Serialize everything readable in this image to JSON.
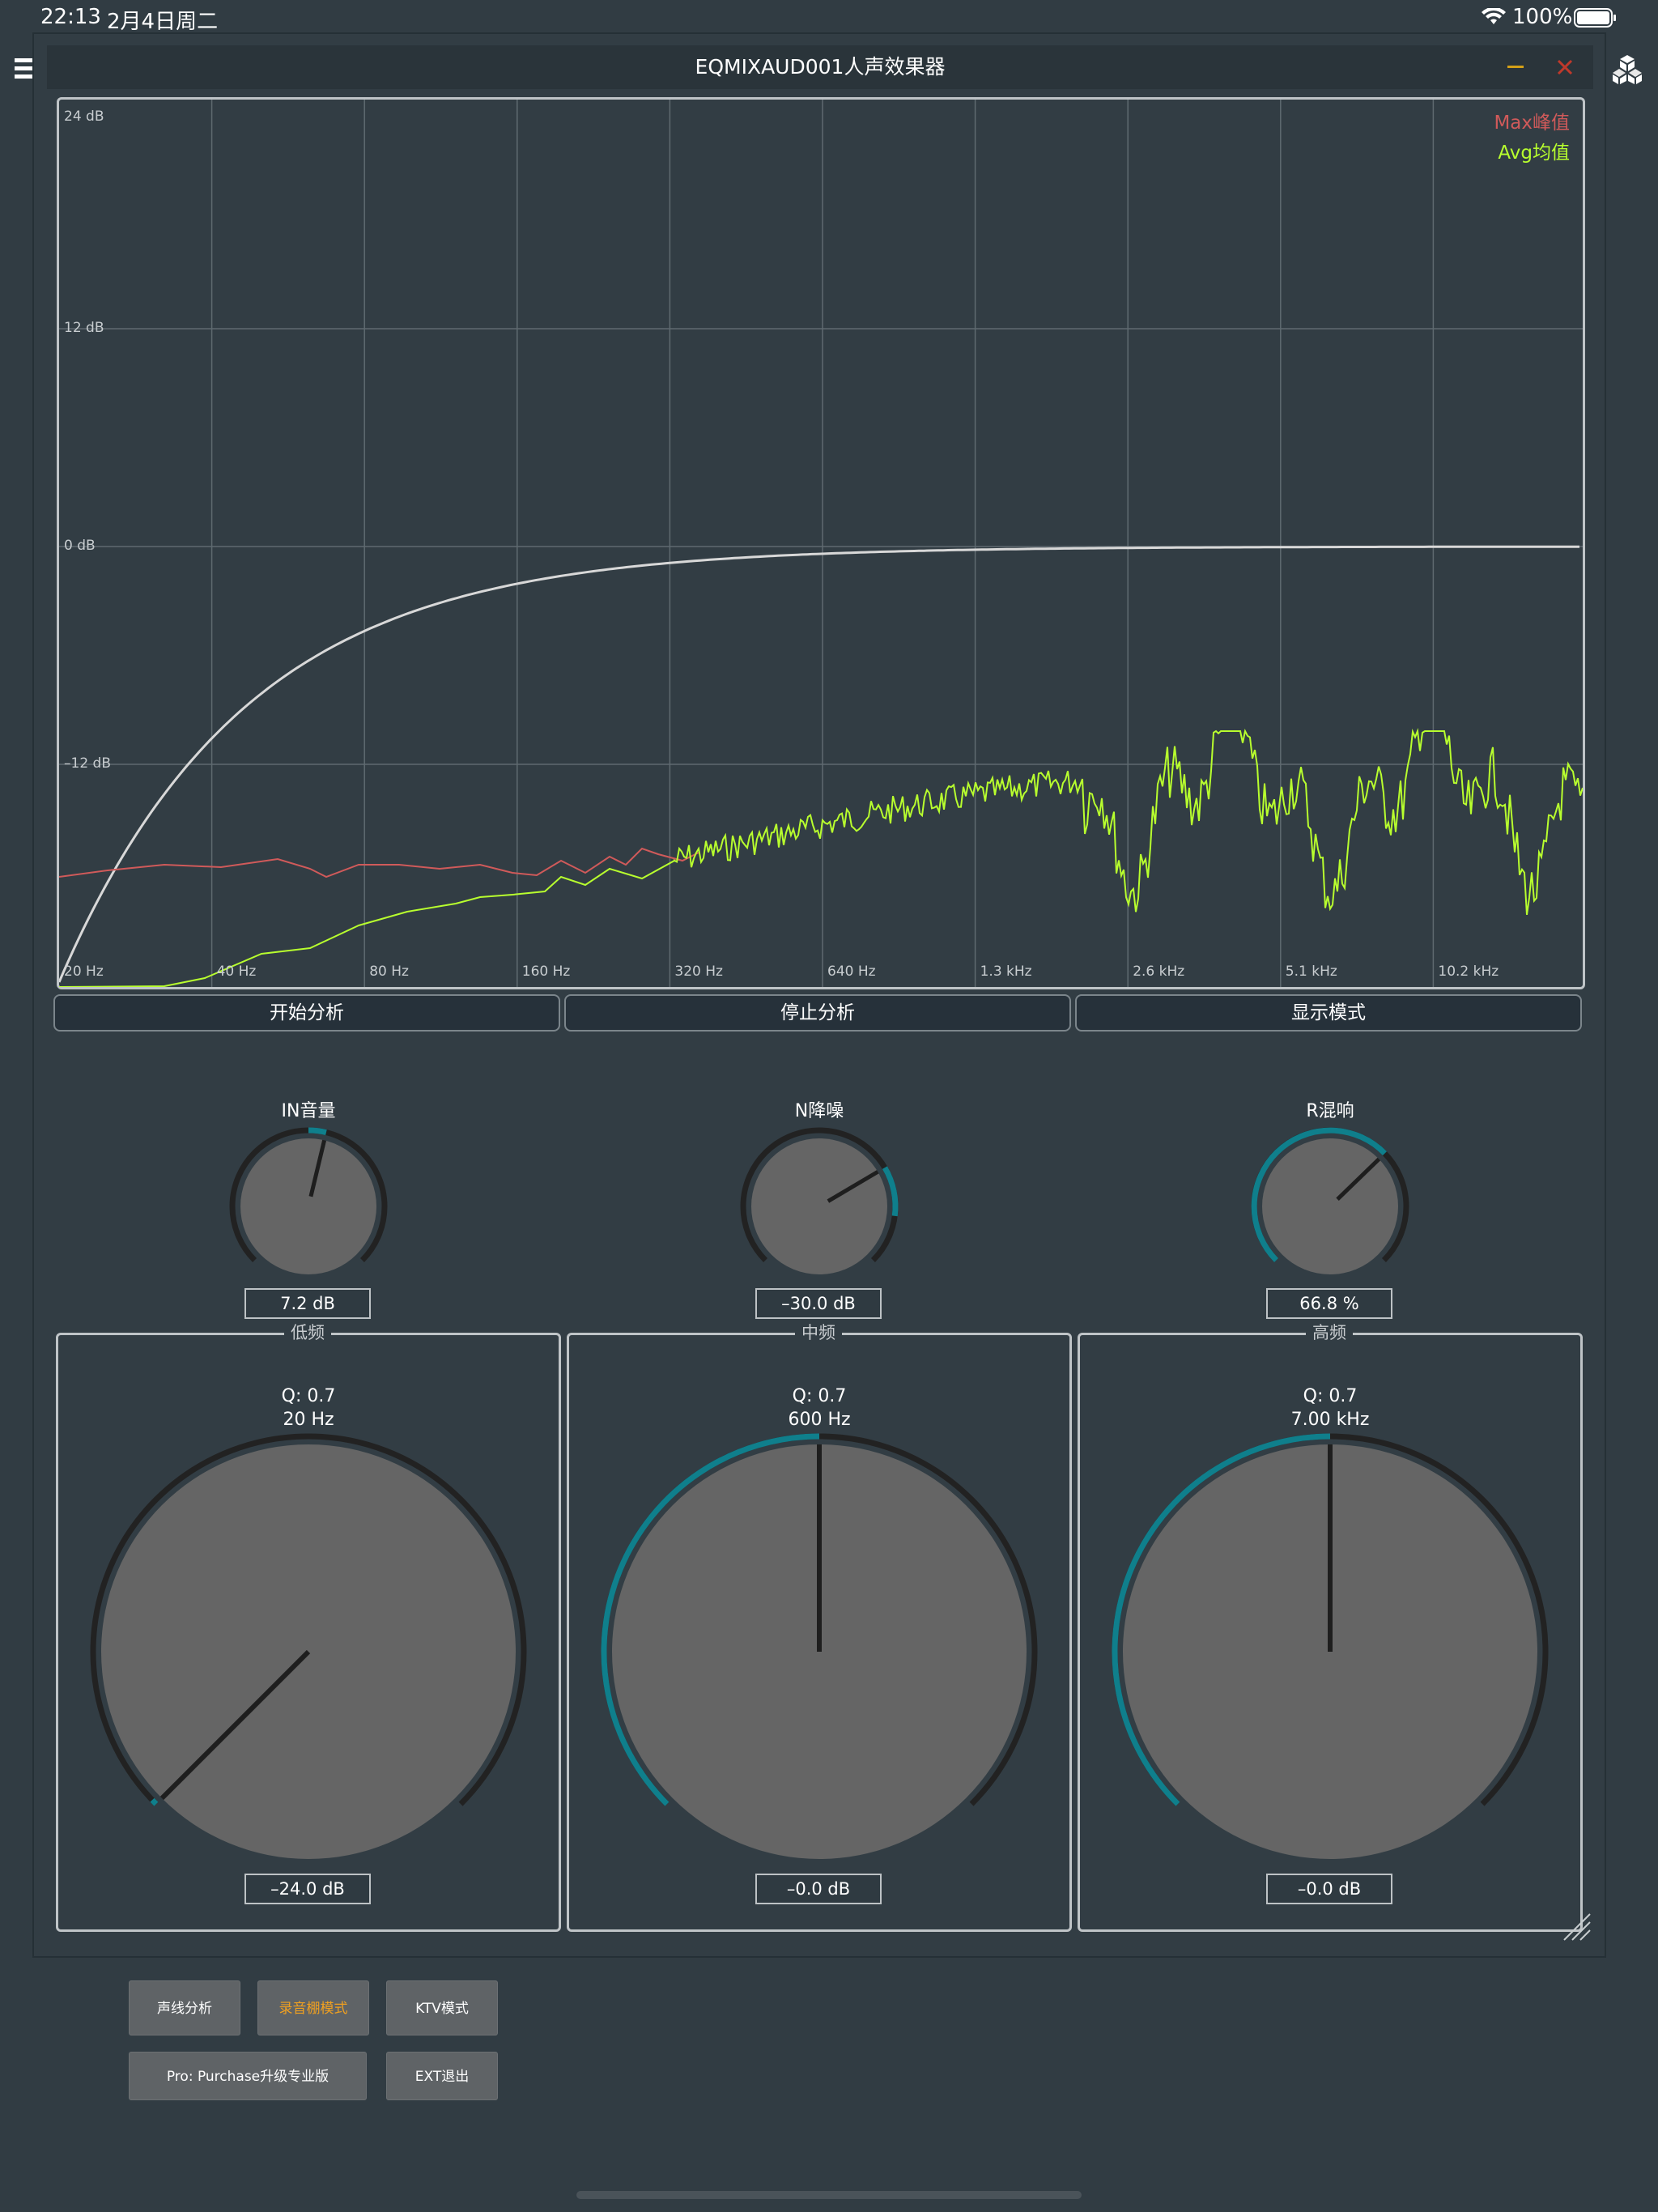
{
  "status_bar": {
    "time": "22:13",
    "date": "2月4日周二",
    "battery": "100%"
  },
  "window": {
    "title": "EQMIXAUD001人声效果器"
  },
  "spectrum": {
    "legend_max": "Max峰值",
    "legend_avg": "Avg均值",
    "db_labels": [
      "24 dB",
      "12 dB",
      "0 dB",
      "–12 dB"
    ],
    "freq_labels": [
      "20 Hz",
      "40 Hz",
      "80 Hz",
      "160 Hz",
      "320 Hz",
      "640 Hz",
      "1.3 kHz",
      "2.6 kHz",
      "5.1 kHz",
      "10.2 kHz"
    ],
    "colors": {
      "max": "#d05a5a",
      "avg": "#b8ff2e",
      "eq": "#d8d8d8",
      "grid": "#5f6a70"
    }
  },
  "analysis_buttons": {
    "start": "开始分析",
    "stop": "停止分析",
    "display": "显示模式"
  },
  "knobs": [
    {
      "label": "IN音量",
      "value": "7.2 dB",
      "level": 0.55
    },
    {
      "label": "N降噪",
      "value": "–30.0 dB",
      "level": 0.72
    },
    {
      "label": "R混响",
      "value": "66.8 %",
      "level": 0.67
    }
  ],
  "bands": [
    {
      "title": "低频",
      "q": "Q: 0.7",
      "freq": "20 Hz",
      "gain": "–24.0 dB",
      "level": 0.0
    },
    {
      "title": "中频",
      "q": "Q: 0.7",
      "freq": "600 Hz",
      "gain": "–0.0 dB",
      "level": 0.5
    },
    {
      "title": "高频",
      "q": "Q: 0.7",
      "freq": "7.00 kHz",
      "gain": "–0.0 dB",
      "level": 0.5
    }
  ],
  "bottom_buttons": {
    "voice_analysis": "声线分析",
    "studio_mode": "录音棚模式",
    "ktv_mode": "KTV模式",
    "purchase": "Pro: Purchase升级专业版",
    "exit": "EXT退出"
  },
  "accent_colors": {
    "knob_arc": "#0f7f8c",
    "studio_mode_text": "#f0a020",
    "minimize": "#d4a017",
    "close": "#c0392b"
  }
}
